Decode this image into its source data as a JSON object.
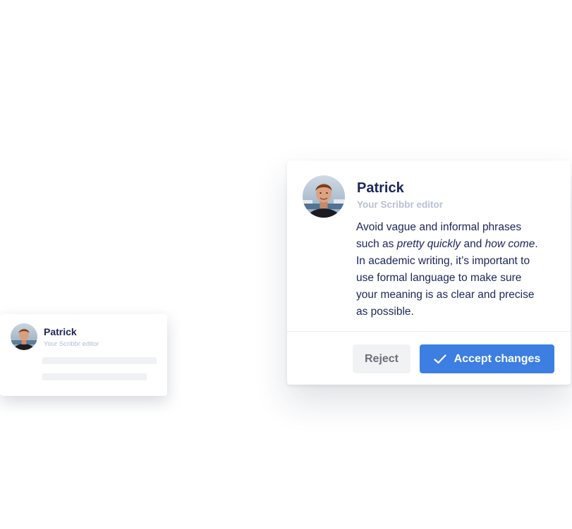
{
  "mini_card": {
    "editor_name": "Patrick",
    "editor_role": "Your Scribbr editor"
  },
  "feedback_card": {
    "editor_name": "Patrick",
    "editor_role": "Your Scribbr editor",
    "comment": {
      "line1": "Avoid vague and informal phrases",
      "line2_prefix": "such as ",
      "phrase1": "pretty quickly",
      "line2_mid": " and ",
      "phrase2": "how come",
      "line2_suffix": ".",
      "line3": "In academic writing, it’s important to",
      "line4": "use formal language to make sure",
      "line5": "your meaning is as clear and precise",
      "line6": "as possible."
    },
    "reject_label": "Reject",
    "accept_label": "Accept changes",
    "accept_icon": "check-icon"
  },
  "colors": {
    "accent": "#3c7ee2",
    "text_primary": "#1b2559",
    "text_muted": "#b8c0d6"
  }
}
